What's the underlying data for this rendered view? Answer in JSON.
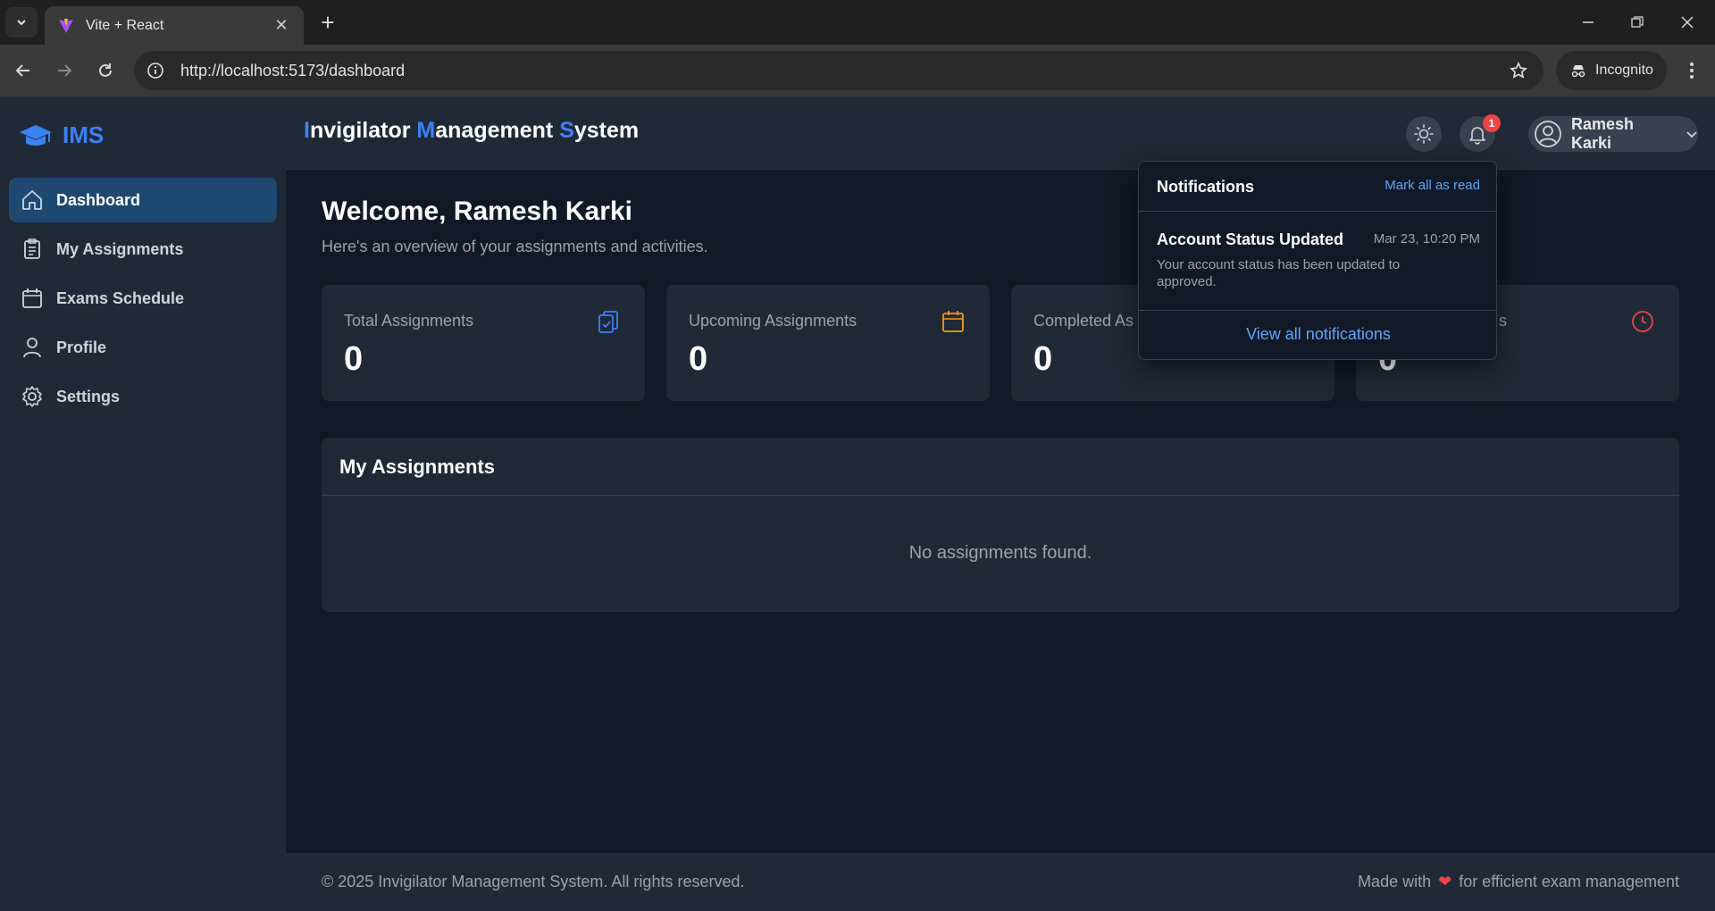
{
  "browser": {
    "tab_title": "Vite + React",
    "url": "http://localhost:5173/dashboard",
    "incognito_label": "Incognito"
  },
  "sidebar": {
    "brand": "IMS",
    "items": [
      {
        "label": "Dashboard",
        "icon": "home-icon",
        "active": true
      },
      {
        "label": "My Assignments",
        "icon": "clipboard-icon",
        "active": false
      },
      {
        "label": "Exams Schedule",
        "icon": "calendar-icon",
        "active": false
      },
      {
        "label": "Profile",
        "icon": "user-icon",
        "active": false
      },
      {
        "label": "Settings",
        "icon": "gear-icon",
        "active": false
      }
    ]
  },
  "header": {
    "title_parts": [
      "I",
      "nvigilator ",
      "M",
      "anagement ",
      "S",
      "ystem"
    ],
    "notification_count": "1",
    "user_name": "Ramesh Karki"
  },
  "main": {
    "welcome": "Welcome, Ramesh Karki",
    "subtitle": "Here's an overview of your assignments and activities.",
    "cards": [
      {
        "label": "Total Assignments",
        "value": "0",
        "icon": "clipboard-check-icon",
        "color": "#3b82f6"
      },
      {
        "label": "Upcoming Assignments",
        "value": "0",
        "icon": "calendar-icon",
        "color": "#f59e0b"
      },
      {
        "label": "Completed As",
        "value": "0",
        "icon": "check-icon",
        "color": "#10b981"
      },
      {
        "label": "s",
        "value": "0",
        "icon": "clock-icon",
        "color": "#ef4444"
      }
    ],
    "panel_title": "My Assignments",
    "panel_empty": "No assignments found."
  },
  "notifications": {
    "title": "Notifications",
    "mark_all": "Mark all as read",
    "items": [
      {
        "title": "Account Status Updated",
        "time": "Mar 23, 10:20 PM",
        "body": "Your account status has been updated to approved."
      }
    ],
    "view_all": "View all notifications"
  },
  "footer": {
    "left": "© 2025 Invigilator Management System. All rights reserved.",
    "right_pre": "Made with",
    "right_post": "for efficient exam management"
  },
  "colors": {
    "accent": "#3b82f6",
    "background": "#111827",
    "surface": "#1f2937",
    "badge": "#ef4444"
  }
}
